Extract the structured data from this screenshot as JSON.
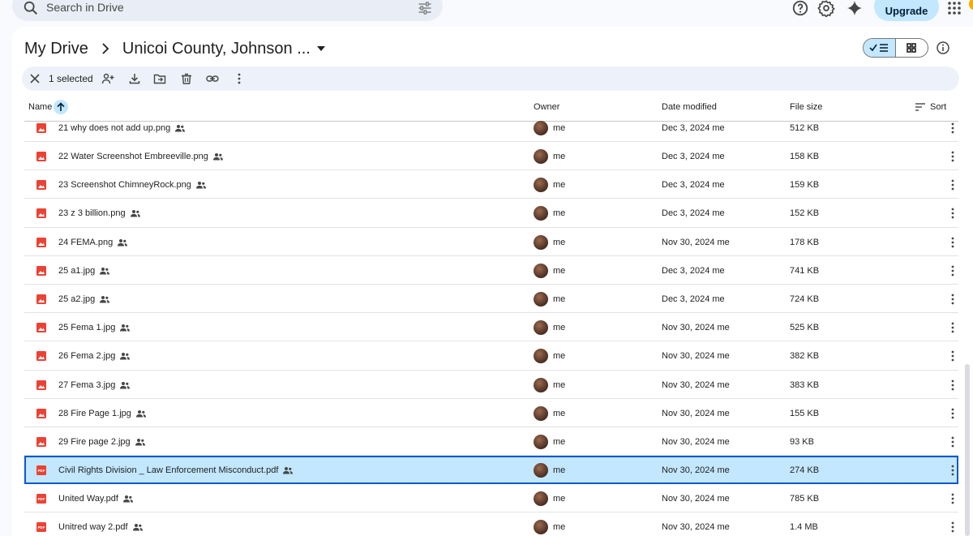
{
  "search": {
    "placeholder": "Search in Drive"
  },
  "topbar": {
    "upgrade_label": "Upgrade"
  },
  "breadcrumb": {
    "root": "My Drive",
    "current": "Unicoi County, Johnson ..."
  },
  "actionbar": {
    "selected_text": "1 selected"
  },
  "columns": {
    "name": "Name",
    "owner": "Owner",
    "date": "Date modified",
    "size": "File size",
    "sort": "Sort"
  },
  "files": [
    {
      "name": "21 why does not add up.png",
      "type": "image",
      "owner": "me",
      "date": "Dec 3, 2024 me",
      "size": "512 KB"
    },
    {
      "name": "22 Water Screenshot Embreeville.png",
      "type": "image",
      "owner": "me",
      "date": "Dec 3, 2024 me",
      "size": "158 KB"
    },
    {
      "name": "23 Screenshot ChimneyRock.png",
      "type": "image",
      "owner": "me",
      "date": "Dec 3, 2024 me",
      "size": "159 KB"
    },
    {
      "name": "23 z 3 billion.png",
      "type": "image",
      "owner": "me",
      "date": "Dec 3, 2024 me",
      "size": "152 KB"
    },
    {
      "name": "24 FEMA.png",
      "type": "image",
      "owner": "me",
      "date": "Nov 30, 2024 me",
      "size": "178 KB"
    },
    {
      "name": "25 a1.jpg",
      "type": "image",
      "owner": "me",
      "date": "Dec 3, 2024 me",
      "size": "741 KB"
    },
    {
      "name": "25 a2.jpg",
      "type": "image",
      "owner": "me",
      "date": "Dec 3, 2024 me",
      "size": "724 KB"
    },
    {
      "name": "25 Fema 1.jpg",
      "type": "image",
      "owner": "me",
      "date": "Nov 30, 2024 me",
      "size": "525 KB"
    },
    {
      "name": "26 Fema 2.jpg",
      "type": "image",
      "owner": "me",
      "date": "Nov 30, 2024 me",
      "size": "382 KB"
    },
    {
      "name": "27 Fema 3.jpg",
      "type": "image",
      "owner": "me",
      "date": "Nov 30, 2024 me",
      "size": "383 KB"
    },
    {
      "name": "28 Fire Page 1.jpg",
      "type": "image",
      "owner": "me",
      "date": "Nov 30, 2024 me",
      "size": "155 KB"
    },
    {
      "name": "29 Fire page 2.jpg",
      "type": "image",
      "owner": "me",
      "date": "Nov 30, 2024 me",
      "size": "93 KB"
    },
    {
      "name": "Civil Rights Division _ Law Enforcement Misconduct.pdf",
      "type": "pdf",
      "owner": "me",
      "date": "Nov 30, 2024 me",
      "size": "274 KB",
      "selected": true
    },
    {
      "name": "United Way.pdf",
      "type": "pdf",
      "owner": "me",
      "date": "Nov 30, 2024 me",
      "size": "785 KB"
    },
    {
      "name": "Unitred way 2.pdf",
      "type": "pdf",
      "owner": "me",
      "date": "Nov 30, 2024 me",
      "size": "1.4 MB"
    }
  ],
  "colors": {
    "accent": "#0b57d0",
    "selected_bg": "#c2e7ff",
    "file_icon": "#ea4335",
    "panel_bg": "#ffffff",
    "page_bg": "#f8fafd"
  },
  "icons": [
    "search-icon",
    "tune-icon",
    "help-icon",
    "settings-icon",
    "gemini-icon",
    "apps-icon",
    "chevron-right-icon",
    "dropdown-icon",
    "list-view-icon",
    "grid-view-icon",
    "info-icon",
    "close-icon",
    "share-icon",
    "download-icon",
    "move-icon",
    "trash-icon",
    "link-icon",
    "more-vert-icon",
    "arrow-up-icon",
    "sort-icon",
    "image-file-icon",
    "pdf-file-icon",
    "shared-icon"
  ]
}
